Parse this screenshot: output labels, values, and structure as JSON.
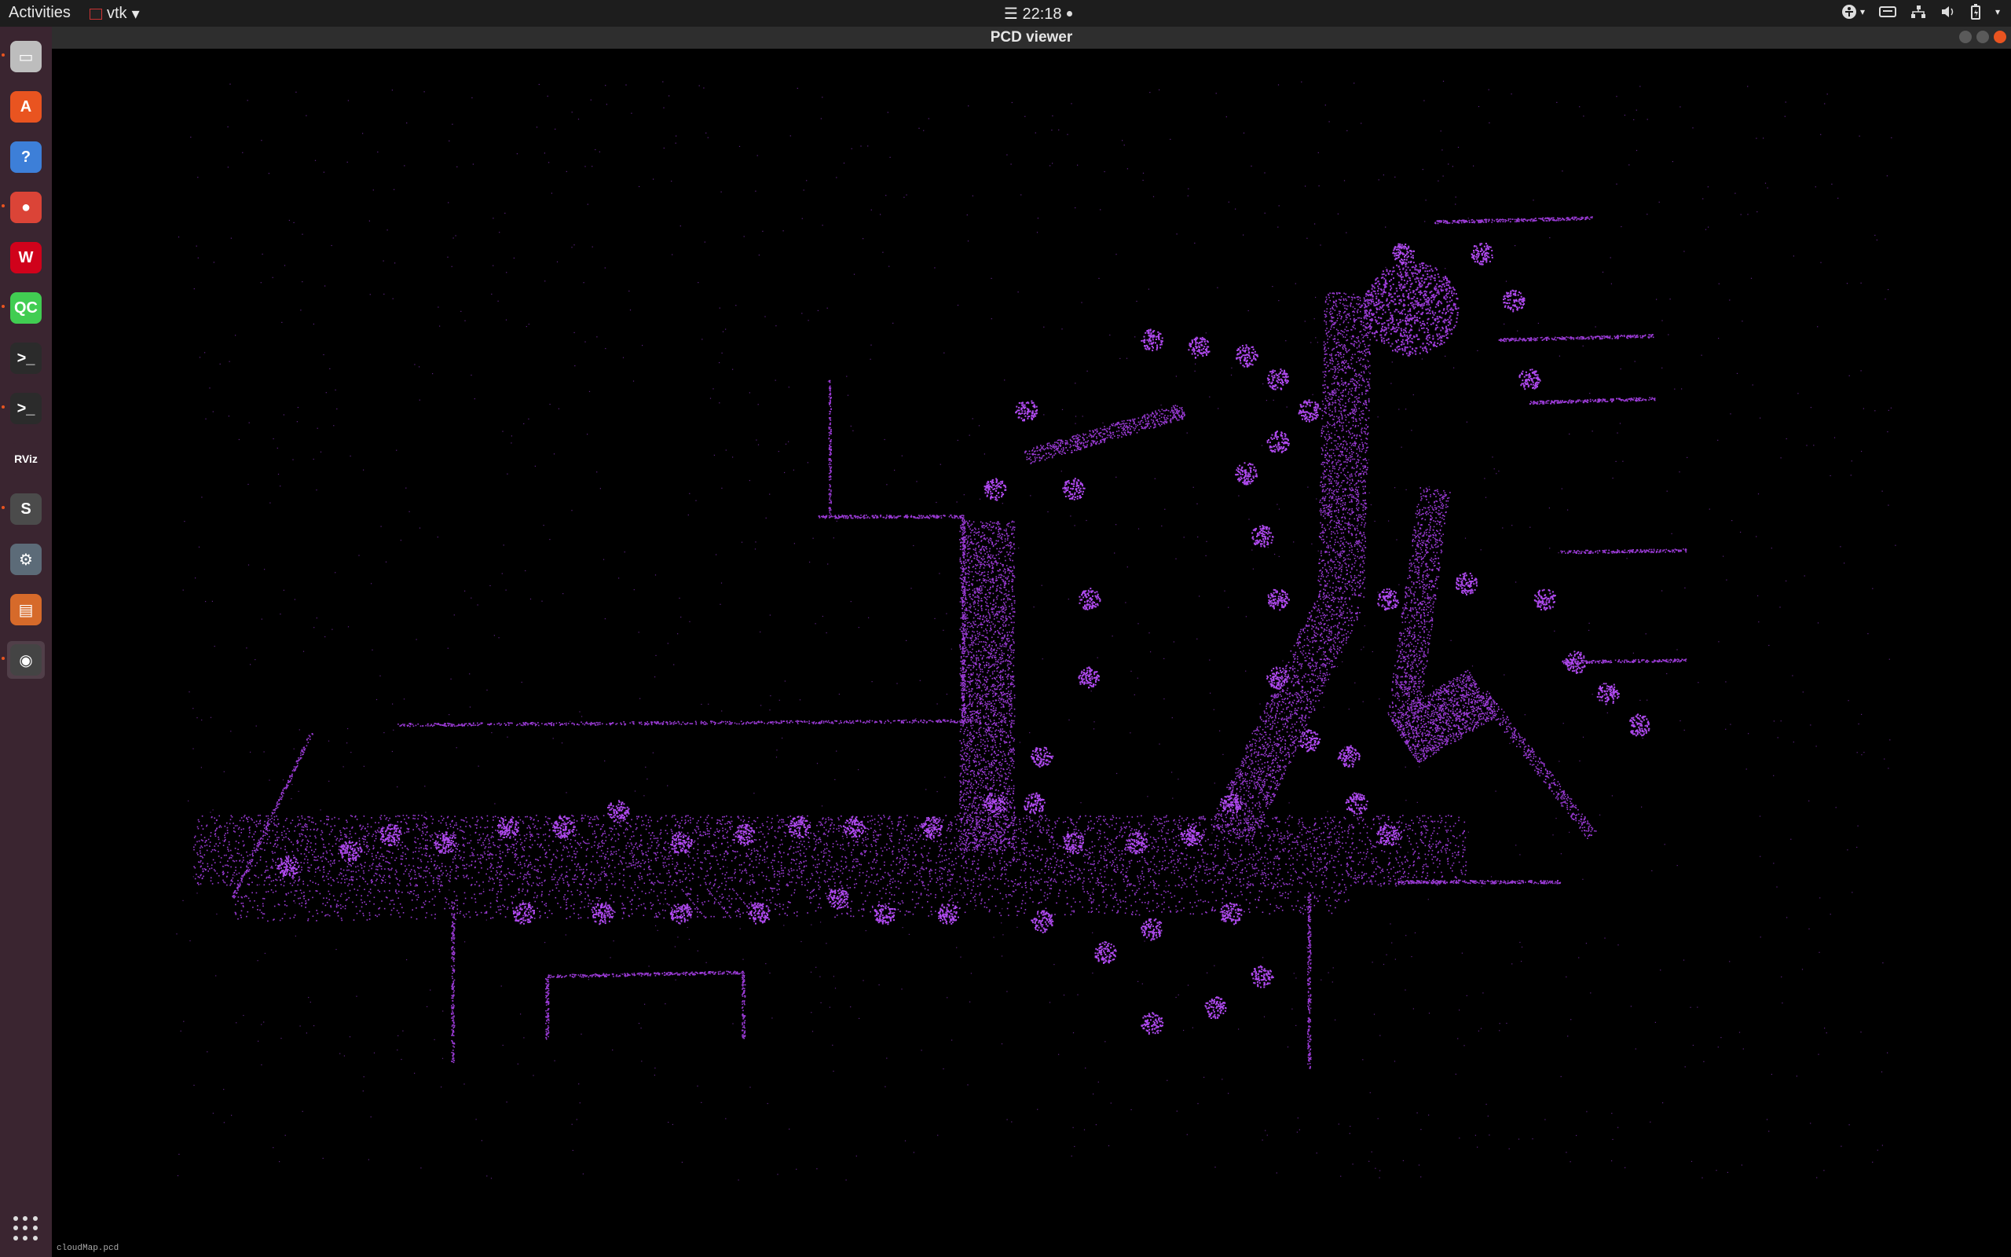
{
  "topbar": {
    "activities": "Activities",
    "app_name": "vtk",
    "clock": "☰ 22:18"
  },
  "window": {
    "title": "PCD viewer",
    "caption": "cloudMap.pcd"
  },
  "dock": [
    {
      "name": "Files",
      "icon": "files-icon",
      "color": "#bdbdbd",
      "running": true
    },
    {
      "name": "Ubuntu Software",
      "icon": "software-center-icon",
      "color": "#e95420",
      "running": false
    },
    {
      "name": "Help",
      "icon": "help-icon",
      "color": "#3d7fd8",
      "running": false
    },
    {
      "name": "Chrome",
      "icon": "chrome-icon",
      "color": "#db4437",
      "running": true
    },
    {
      "name": "WPS",
      "icon": "wps-icon",
      "color": "#d0021b",
      "running": false
    },
    {
      "name": "Qt Creator",
      "icon": "qt-creator-icon",
      "color": "#41cd52",
      "running": true
    },
    {
      "name": "Terminal",
      "icon": "terminal-icon",
      "color": "#2b2b2b",
      "running": false
    },
    {
      "name": "Terminal 2",
      "icon": "terminal-icon",
      "color": "#2b2b2b",
      "running": true
    },
    {
      "name": "RViz",
      "icon": "rviz-icon",
      "color": "#3a2530",
      "running": false
    },
    {
      "name": "Sublime Text",
      "icon": "sublime-icon",
      "color": "#4b4b4b",
      "running": true
    },
    {
      "name": "Settings",
      "icon": "settings-icon",
      "color": "#5c6b78",
      "running": false
    },
    {
      "name": "Archive",
      "icon": "archive-icon",
      "color": "#d66a2a",
      "running": false
    },
    {
      "name": "PCD viewer",
      "icon": "pcd-viewer-icon",
      "color": "#444",
      "running": true
    }
  ],
  "colors": {
    "point": "#9b3bd6",
    "point_bright": "#b04af0"
  }
}
